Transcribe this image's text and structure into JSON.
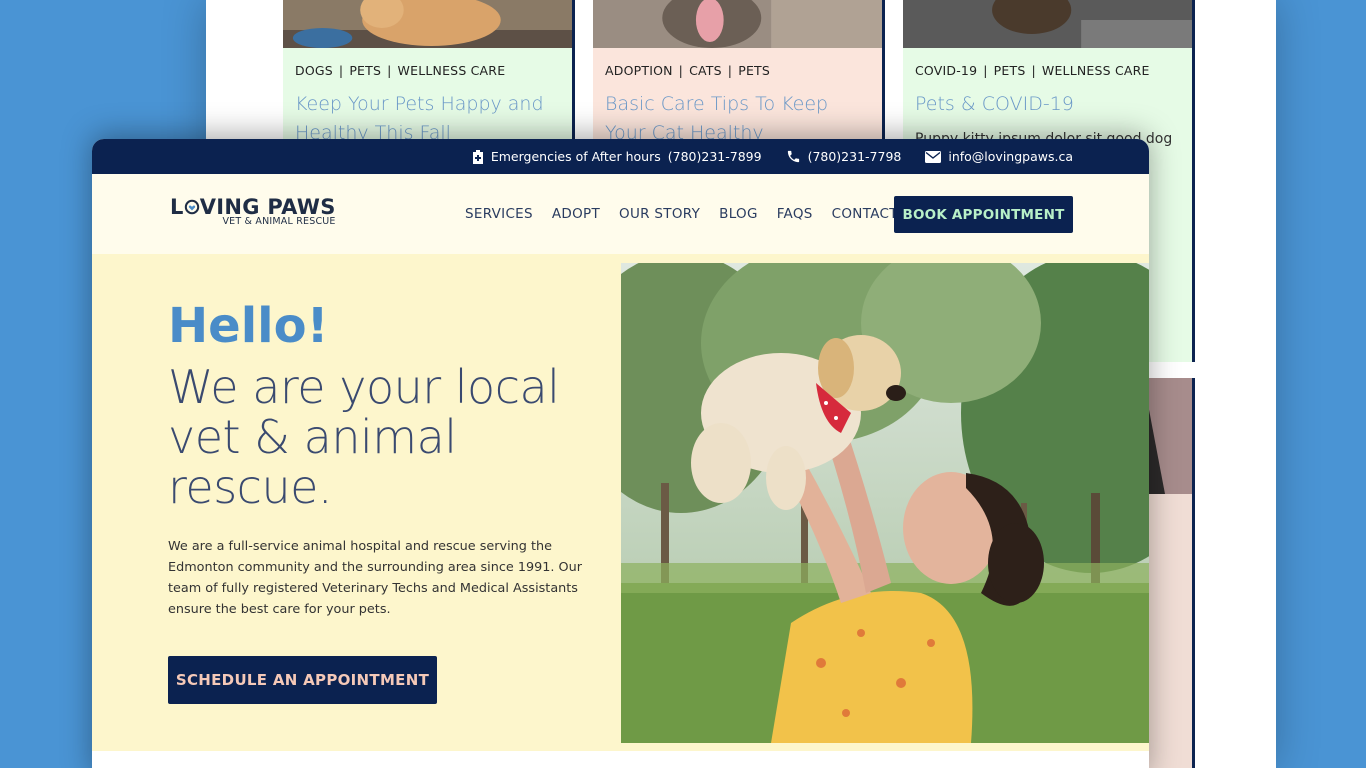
{
  "blog": {
    "cards": [
      {
        "categories": [
          "DOGS",
          "PETS",
          "WELLNESS CARE"
        ],
        "title": "Keep Your Pets Happy and Healthy This Fall",
        "bg": "#e6fbe6"
      },
      {
        "categories": [
          "ADOPTION",
          "CATS",
          "PETS"
        ],
        "title": "Basic Care Tips To Keep Your Cat Healthy",
        "bg": "#fbe5dc"
      },
      {
        "categories": [
          "COVID-19",
          "PETS",
          "WELLNESS CARE"
        ],
        "title": "Pets & COVID-19",
        "excerpt": "Puppy kitty ipsum dolor sit good dog",
        "bg": "#e6fbe6"
      }
    ]
  },
  "topbar": {
    "emergency_label": "Emergencies of After hours",
    "emergency_phone": "(780)231-7899",
    "phone": "(780)231-7798",
    "email": "info@lovingpaws.ca"
  },
  "brand": {
    "name_start": "L",
    "name_end": "VING PAWS",
    "tagline": "VET & ANIMAL RESCUE"
  },
  "nav": {
    "items": [
      "SERVICES",
      "ADOPT",
      "OUR STORY",
      "BLOG",
      "FAQS",
      "CONTACT"
    ],
    "cta": "BOOK APPOINTMENT"
  },
  "hero": {
    "greeting": "Hello!",
    "headline": "We are your local vet & animal rescue.",
    "intro": "We are a full-service animal hospital and rescue serving the Edmonton community and the surrounding area since 1991. Our team of fully registered Veterinary Techs and Medical Assistants ensure the best care for your pets.",
    "cta": "SCHEDULE AN APPOINTMENT"
  },
  "colors": {
    "navy": "#0b2250",
    "accent_blue": "#4a8cc8",
    "hero_bg": "#fdf6cc",
    "page_bg": "#4a94d4"
  }
}
